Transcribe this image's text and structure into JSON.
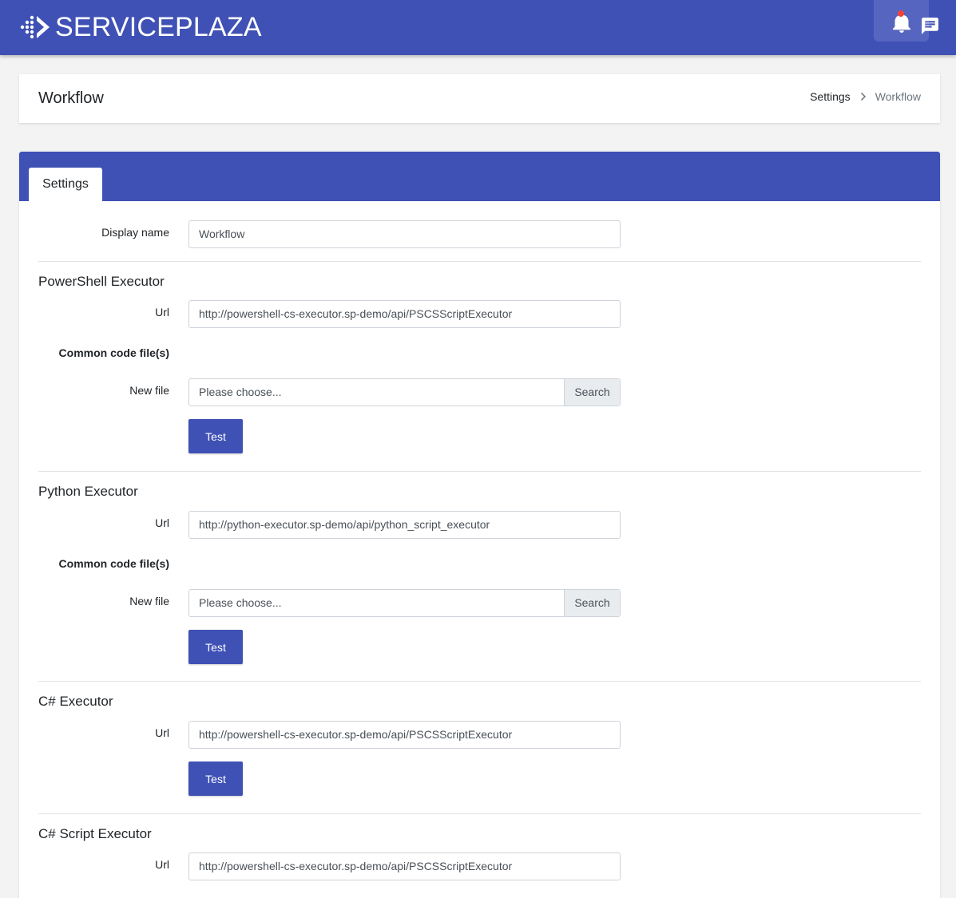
{
  "app": {
    "brand": "SERVICEPLAZA"
  },
  "header": {
    "title": "Workflow",
    "breadcrumb": {
      "parent": "Settings",
      "current": "Workflow"
    }
  },
  "tabs": [
    {
      "label": "Settings",
      "active": true
    }
  ],
  "form": {
    "display_name": {
      "label": "Display name",
      "value": "Workflow"
    },
    "sections": [
      {
        "title": "PowerShell Executor",
        "url_label": "Url",
        "url_value": "http://powershell-cs-executor.sp-demo/api/PSCSScriptExecutor",
        "common_label": "Common code file(s)",
        "new_file_label": "New file",
        "file_placeholder": "Please choose...",
        "search_label": "Search",
        "test_label": "Test"
      },
      {
        "title": "Python Executor",
        "url_label": "Url",
        "url_value": "http://python-executor.sp-demo/api/python_script_executor",
        "common_label": "Common code file(s)",
        "new_file_label": "New file",
        "file_placeholder": "Please choose...",
        "search_label": "Search",
        "test_label": "Test"
      },
      {
        "title": "C# Executor",
        "url_label": "Url",
        "url_value": "http://powershell-cs-executor.sp-demo/api/PSCSScriptExecutor",
        "test_label": "Test"
      },
      {
        "title": "C# Script Executor",
        "url_label": "Url",
        "url_value": "http://powershell-cs-executor.sp-demo/api/PSCSScriptExecutor"
      }
    ]
  },
  "icons": {
    "logo": "serviceplaza-logo-icon",
    "notifications": "bell-icon",
    "messages": "chat-icon",
    "breadcrumb_separator": "chevron-right-icon"
  },
  "colors": {
    "primary": "#3f51b5",
    "notification_dot": "#f44336",
    "background": "#f3f3f3"
  }
}
